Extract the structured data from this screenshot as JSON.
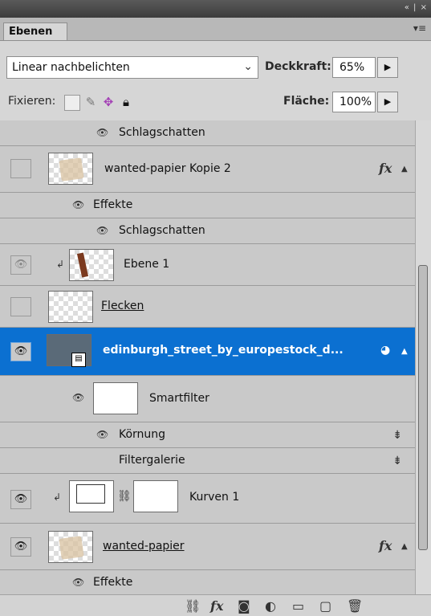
{
  "panel": {
    "tab_label": "Ebenen",
    "collapse_glyph": "«",
    "close_glyph": "×",
    "menu_glyph": "▾≡"
  },
  "blend": {
    "mode": "Linear nachbelichten",
    "opacity_label": "Deckkraft:",
    "opacity_value": "65%",
    "lock_label": "Fixieren:",
    "fill_label": "Fläche:",
    "fill_value": "100%"
  },
  "layers": [
    {
      "kind": "effect",
      "label": "Schlagschatten",
      "visible": true
    },
    {
      "kind": "layer",
      "name": "wanted-papier Kopie 2",
      "visible": false,
      "thumbnail": "paper",
      "has_fx": true,
      "expanded": true
    },
    {
      "kind": "effects-header",
      "label": "Effekte",
      "visible": true
    },
    {
      "kind": "effect",
      "label": "Schlagschatten",
      "visible": true
    },
    {
      "kind": "layer",
      "name": "Ebene 1",
      "visible": true,
      "dim": true,
      "clipped": true,
      "thumbnail": "figure"
    },
    {
      "kind": "layer",
      "name": "Flecken",
      "visible": false,
      "thumbnail": "transparent",
      "underline": true
    },
    {
      "kind": "layer",
      "name": "edinburgh_street_by_europestock_d...",
      "visible": true,
      "selected": true,
      "thumbnail": "smartobject",
      "has_filter": true
    },
    {
      "kind": "smartfilter",
      "label": "Smartfilter",
      "visible": true
    },
    {
      "kind": "filter",
      "label": "Körnung",
      "visible": true
    },
    {
      "kind": "filter",
      "label": "Filtergalerie",
      "visible": false
    },
    {
      "kind": "adjustment",
      "name": "Kurven 1",
      "visible": true,
      "clipped": true,
      "thumbnail": "curves"
    },
    {
      "kind": "layer",
      "name": "wanted-papier",
      "visible": true,
      "thumbnail": "paper",
      "has_fx": true,
      "underline": true
    },
    {
      "kind": "effects-header",
      "label": "Effekte",
      "visible": true
    }
  ],
  "icons": {
    "eye": "eye-icon",
    "fx": "fx-icon",
    "lock": "lock-icon",
    "link": "link-icon",
    "mask": "mask-icon",
    "adjustment": "adjustment-icon",
    "folder": "folder-icon",
    "new_layer": "new-layer-icon",
    "trash": "trash-icon"
  },
  "colors": {
    "selected": "#0b70d1",
    "panel": "#c9c9c9",
    "title": "#3c3c3c"
  }
}
